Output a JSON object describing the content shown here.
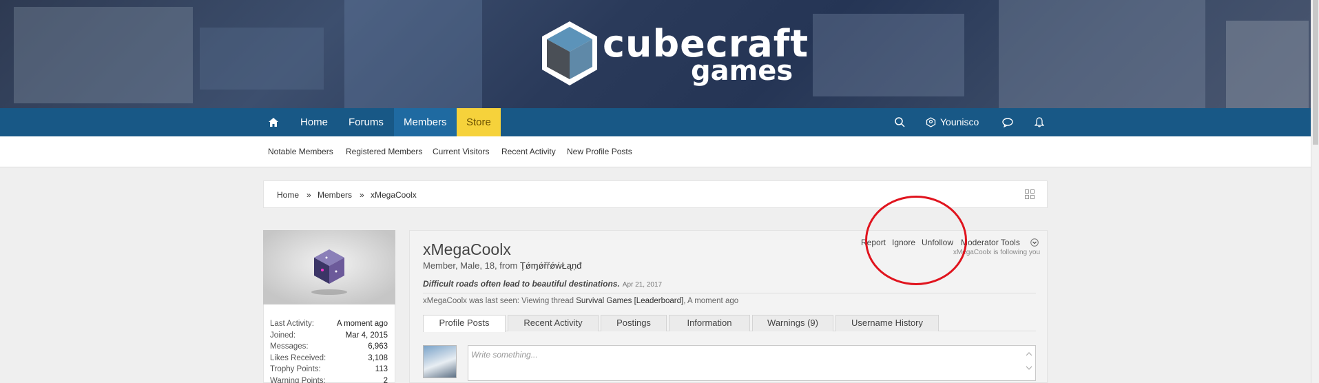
{
  "brand": {
    "line1": "cubecraft",
    "line2": "games"
  },
  "nav": {
    "items": [
      "Home",
      "Forums",
      "Members",
      "Store"
    ],
    "user": "Younisco"
  },
  "subnav": [
    "Notable Members",
    "Registered Members",
    "Current Visitors",
    "Recent Activity",
    "New Profile Posts"
  ],
  "breadcrumb": {
    "home": "Home",
    "sep1": "»",
    "members": "Members",
    "sep2": "»",
    "current": "xMegaCoolx"
  },
  "stats": [
    {
      "k": "Last Activity:",
      "v": "A moment ago"
    },
    {
      "k": "Joined:",
      "v": "Mar 4, 2015"
    },
    {
      "k": "Messages:",
      "v": "6,963"
    },
    {
      "k": "Likes Received:",
      "v": "3,108"
    },
    {
      "k": "Trophy Points:",
      "v": "113"
    },
    {
      "k": "Warning Points:",
      "v": "2"
    }
  ],
  "profile": {
    "name": "xMegaCoolx",
    "meta": "Member, Male, 18, from",
    "location": "ŢǿɱǿřřǿẃŁąņđ",
    "status": "Difficult roads often lead to beautiful destinations.",
    "status_date": "Apr 21, 2017",
    "last_seen_prefix": "xMegaCoolx was last seen: Viewing thread",
    "last_seen_thread": "Survival Games [Leaderboard]",
    "last_seen_suffix": ", A moment ago"
  },
  "actions": {
    "report": "Report",
    "ignore": "Ignore",
    "unfollow": "Unfollow",
    "moderator_tools": "Moderator Tools",
    "follow_note": "xMegaCoolx is following you"
  },
  "tabs": [
    "Profile Posts",
    "Recent Activity",
    "Postings",
    "Information",
    "Warnings (9)",
    "Username History"
  ],
  "post_box": {
    "placeholder": "Write something..."
  },
  "colors": {
    "navbar": "#185886",
    "store": "#f6d23b",
    "annotation": "#e0141e"
  }
}
